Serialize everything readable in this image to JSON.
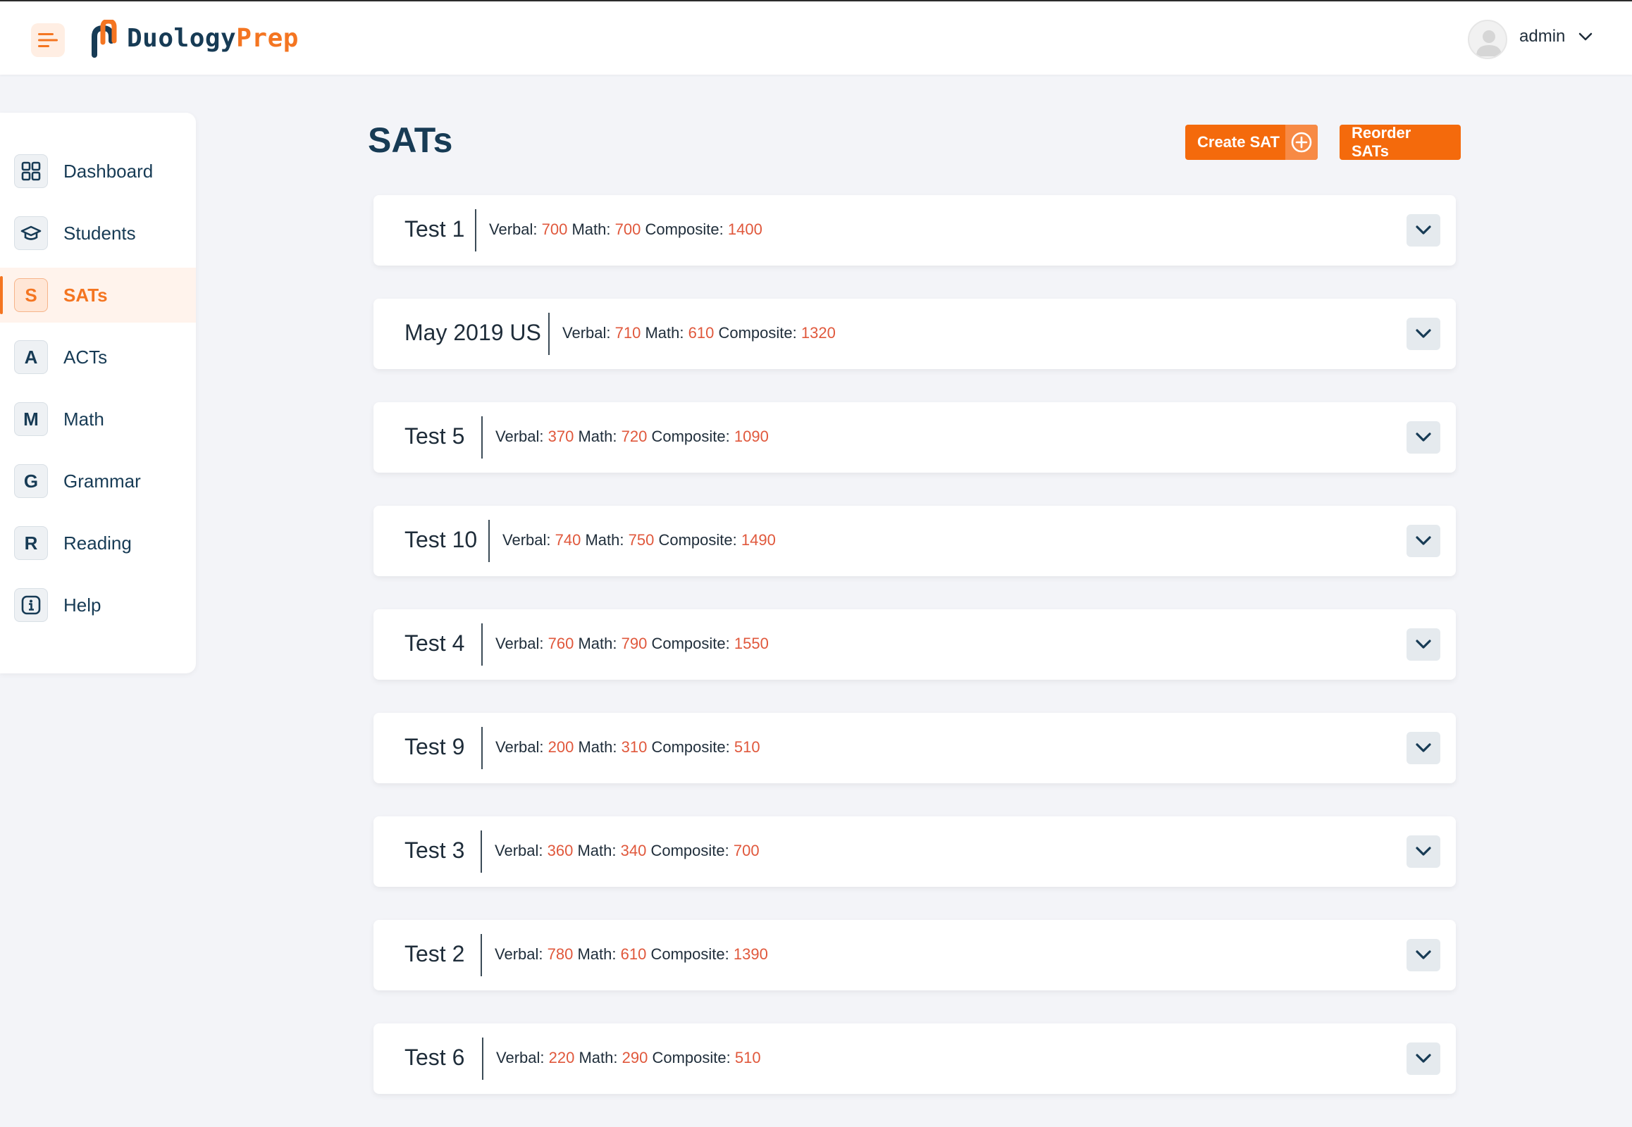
{
  "header": {
    "logo_part1": "Duology",
    "logo_part2": "Prep",
    "user_name": "admin",
    "colors": {
      "brand_orange": "#f47521",
      "brand_navy": "#173b55"
    }
  },
  "sidebar": {
    "items": [
      {
        "label": "Dashboard",
        "icon": "grid-icon",
        "glyph": "",
        "active": false
      },
      {
        "label": "Students",
        "icon": "graduation-cap-icon",
        "glyph": "",
        "active": false
      },
      {
        "label": "SATs",
        "icon": "letter-s-icon",
        "glyph": "S",
        "active": true
      },
      {
        "label": "ACTs",
        "icon": "letter-a-icon",
        "glyph": "A",
        "active": false
      },
      {
        "label": "Math",
        "icon": "letter-m-icon",
        "glyph": "M",
        "active": false
      },
      {
        "label": "Grammar",
        "icon": "letter-g-icon",
        "glyph": "G",
        "active": false
      },
      {
        "label": "Reading",
        "icon": "letter-r-icon",
        "glyph": "R",
        "active": false
      },
      {
        "label": "Help",
        "icon": "info-icon",
        "glyph": "",
        "active": false
      }
    ]
  },
  "main": {
    "title": "SATs",
    "create_label": "Create SAT",
    "reorder_label": "Reorder SATs",
    "score_labels": {
      "verbal": "Verbal:",
      "math": "Math:",
      "composite": "Composite:"
    },
    "tests": [
      {
        "name": "Test 1",
        "verbal": "700",
        "math": "700",
        "composite": "1400"
      },
      {
        "name": "May 2019 US",
        "verbal": "710",
        "math": "610",
        "composite": "1320"
      },
      {
        "name": "Test 5",
        "verbal": "370",
        "math": "720",
        "composite": "1090"
      },
      {
        "name": "Test 10",
        "verbal": "740",
        "math": "750",
        "composite": "1490"
      },
      {
        "name": "Test 4",
        "verbal": "760",
        "math": "790",
        "composite": "1550"
      },
      {
        "name": "Test 9",
        "verbal": "200",
        "math": "310",
        "composite": "510"
      },
      {
        "name": "Test 3",
        "verbal": "360",
        "math": "340",
        "composite": "700"
      },
      {
        "name": "Test 2",
        "verbal": "780",
        "math": "610",
        "composite": "1390"
      },
      {
        "name": "Test 6",
        "verbal": "220",
        "math": "290",
        "composite": "510"
      }
    ]
  }
}
